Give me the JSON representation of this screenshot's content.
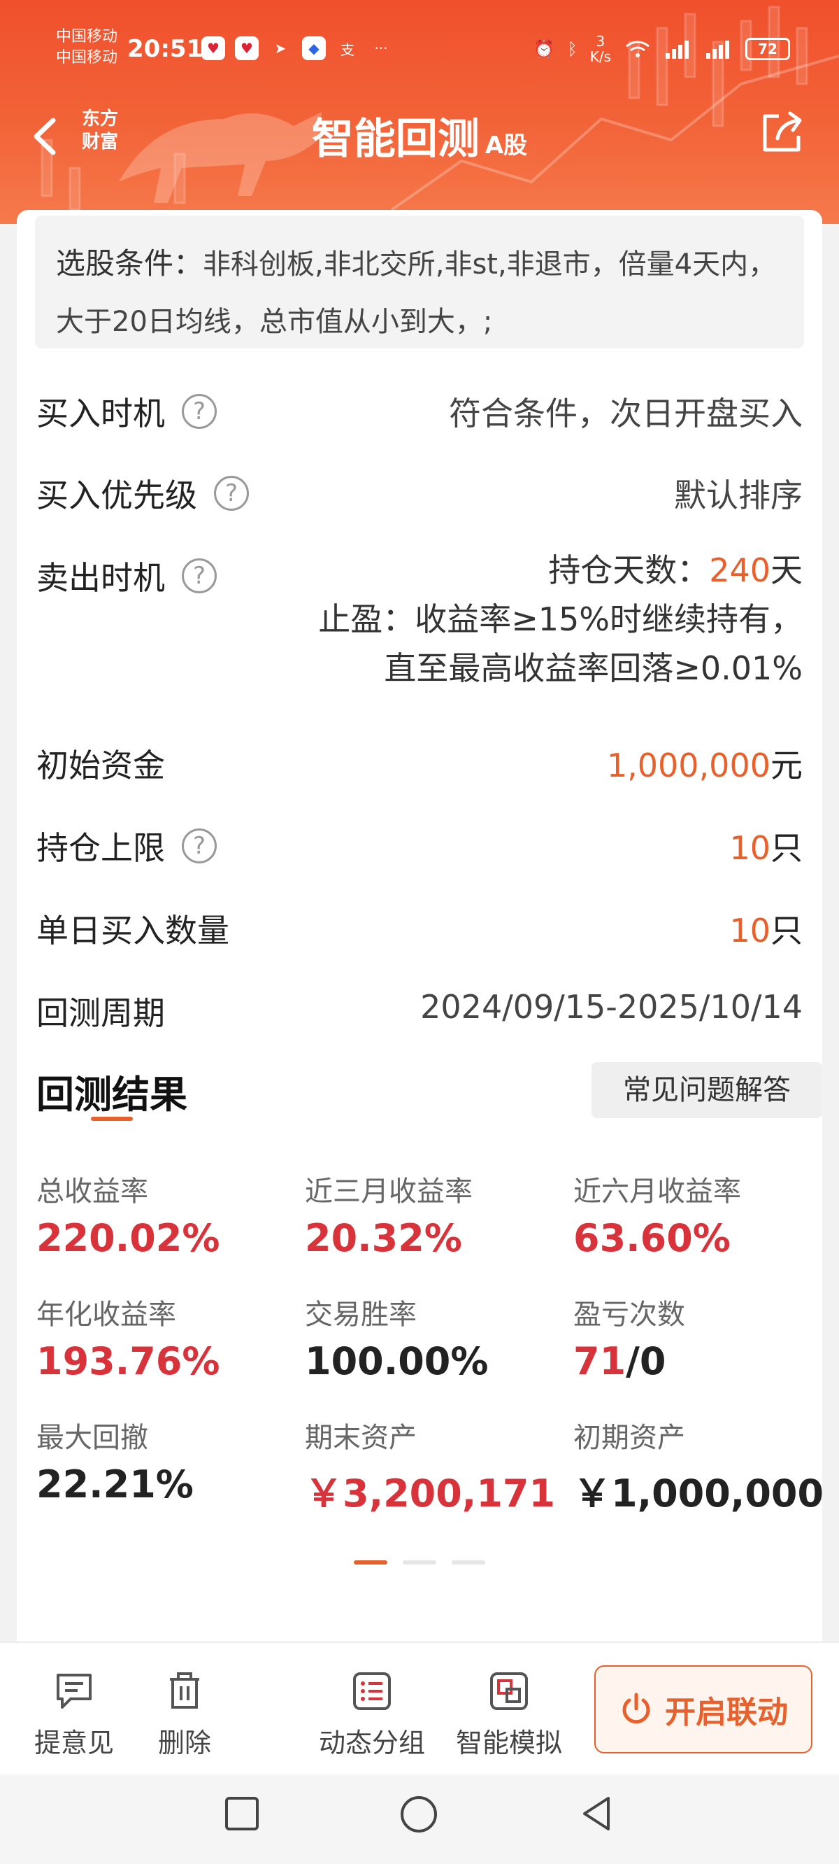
{
  "status_bar": {
    "carrier_1": "中国移动",
    "carrier_2": "中国移动",
    "time": "20:51",
    "net_speed_value": "3",
    "net_speed_unit": "K/s",
    "battery": "72",
    "more": "···"
  },
  "nav": {
    "brand_line1": "东方",
    "brand_line2": "财富",
    "title": "智能回测",
    "title_suffix": "A股"
  },
  "conditions": {
    "label": "选股条件：",
    "text": "非科创板,非北交所,非st,非退市，倍量4天内，大于20日均线，总市值从小到大，;"
  },
  "settings": {
    "buy_timing": {
      "label": "买入时机",
      "value": "符合条件，次日开盘买入"
    },
    "buy_priority": {
      "label": "买入优先级",
      "value": "默认排序"
    },
    "sell_timing": {
      "label": "卖出时机",
      "line1_prefix": "持仓天数：",
      "hold_days": "240",
      "line1_suffix": "天",
      "line2": "止盈：收益率≥15%时继续持有，",
      "line3": "直至最高收益率回落≥0.01%"
    },
    "initial_capital": {
      "label": "初始资金",
      "value": "1,000,000",
      "unit": "元"
    },
    "position_limit": {
      "label": "持仓上限",
      "value": "10",
      "unit": "只"
    },
    "daily_buy_count": {
      "label": "单日买入数量",
      "value": "10",
      "unit": "只"
    },
    "backtest_period": {
      "label": "回测周期",
      "value": "2024/09/15-2025/10/14"
    }
  },
  "results": {
    "title": "回测结果",
    "faq_label": "常见问题解答",
    "metrics": [
      {
        "label": "总收益率",
        "value": "220.02%"
      },
      {
        "label": "近三月收益率",
        "value": "20.32%"
      },
      {
        "label": "近六月收益率",
        "value": "63.60%"
      },
      {
        "label": "年化收益率",
        "value": "193.76%"
      },
      {
        "label": "交易胜率",
        "value": "100.00%"
      },
      {
        "label": "盈亏次数",
        "value_win": "71",
        "value_rest": "/0"
      },
      {
        "label": "最大回撤",
        "value": "22.21%"
      },
      {
        "label": "期末资产",
        "value": "￥3,200,171"
      },
      {
        "label": "初期资产",
        "value": "￥1,000,000"
      }
    ]
  },
  "toolbar": {
    "feedback": "提意见",
    "delete": "删除",
    "dynamic_group": "动态分组",
    "smart_sim": "智能模拟",
    "link": "开启联动"
  },
  "colors": {
    "accent": "#e8612c",
    "red": "#d8333b",
    "header": "#f0502c"
  }
}
